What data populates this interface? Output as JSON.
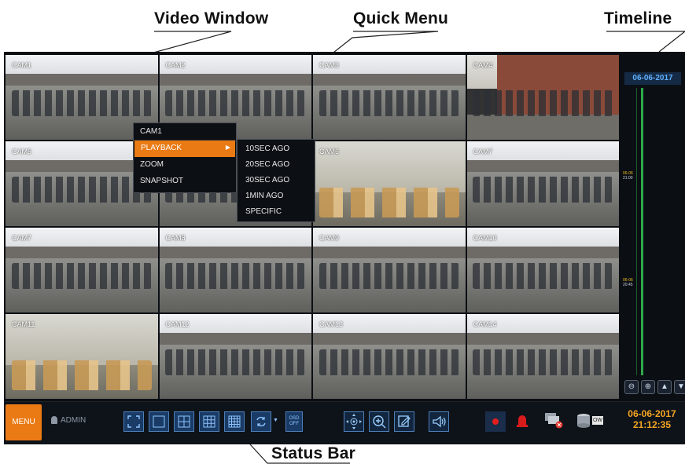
{
  "callouts": {
    "video_window": "Video Window",
    "quick_menu": "Quick Menu",
    "timeline": "Timeline",
    "status_bar": "Status Bar"
  },
  "cameras": [
    {
      "label": "CAM1",
      "scene": "lot"
    },
    {
      "label": "CAM2",
      "scene": "lot"
    },
    {
      "label": "CAM3",
      "scene": "lot"
    },
    {
      "label": "CAM4",
      "scene": "brick"
    },
    {
      "label": "CAM5",
      "scene": "lot"
    },
    {
      "label": "",
      "scene": "lot"
    },
    {
      "label": "CAM6",
      "scene": "indoor"
    },
    {
      "label": "CAM7",
      "scene": "lot"
    },
    {
      "label": "CAM7",
      "scene": "lot"
    },
    {
      "label": "CAM8",
      "scene": "lot"
    },
    {
      "label": "CAM9",
      "scene": "lot"
    },
    {
      "label": "CAM10",
      "scene": "lot"
    },
    {
      "label": "CAM11",
      "scene": "indoor"
    },
    {
      "label": "CAM12",
      "scene": "lot"
    },
    {
      "label": "CAM13",
      "scene": "lot"
    },
    {
      "label": "CAM14",
      "scene": "lot"
    }
  ],
  "quick_menu": {
    "title": "CAM1",
    "items": [
      "PLAYBACK",
      "ZOOM",
      "SNAPSHOT"
    ],
    "submenu": [
      "10SEC AGO",
      "20SEC AGO",
      "30SEC AGO",
      "1MIN AGO",
      "SPECIFIC"
    ]
  },
  "timeline": {
    "date": "06-06-2017",
    "marks": [
      {
        "date": "06-06",
        "time": "21:00"
      },
      {
        "date": "06-06",
        "time": "20:45"
      }
    ]
  },
  "status_bar": {
    "menu_label": "MENU",
    "user": "ADMIN",
    "osd_line1": "OSD",
    "osd_line2": "OFF",
    "hdd_label": "OW",
    "date": "06-06-2017",
    "time": "21:12:35"
  },
  "colors": {
    "accent": "#ea7a14",
    "selection": "#3fe0e6",
    "timeline_track": "#2fa84a",
    "clock": "#f5a623",
    "record": "#e41e1e"
  }
}
